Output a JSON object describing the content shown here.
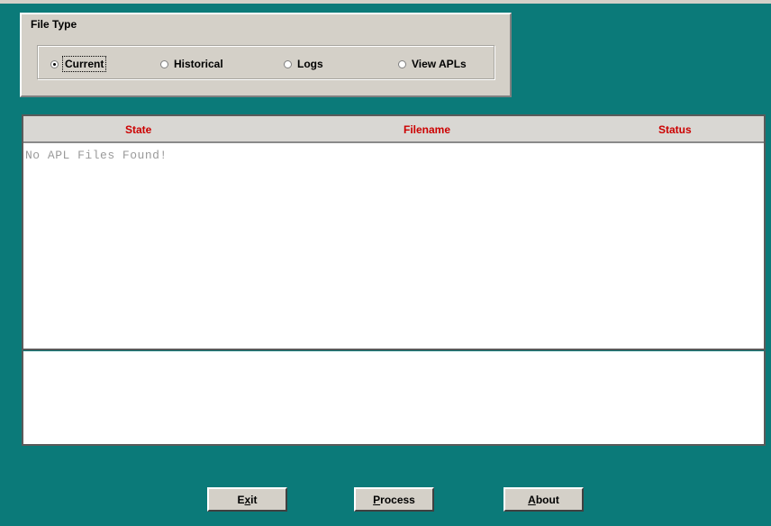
{
  "file_type": {
    "legend": "File Type",
    "options": [
      {
        "label": "Current",
        "checked": true
      },
      {
        "label": "Historical",
        "checked": false
      },
      {
        "label": "Logs",
        "checked": false
      },
      {
        "label": "View APLs",
        "checked": false
      }
    ]
  },
  "list": {
    "columns": [
      "State",
      "Filename",
      "Status"
    ],
    "empty_message": "No APL Files Found!"
  },
  "buttons": {
    "exit": {
      "mnemonic": "x",
      "pre": "E",
      "post": "it"
    },
    "process": {
      "mnemonic": "P",
      "pre": "",
      "post": "rocess"
    },
    "about": {
      "mnemonic": "A",
      "pre": "",
      "post": "bout"
    }
  },
  "colors": {
    "background": "#0b7a79",
    "panel": "#d4d0c8",
    "header_text": "#cc0000",
    "empty_text": "#9a9a9a"
  }
}
